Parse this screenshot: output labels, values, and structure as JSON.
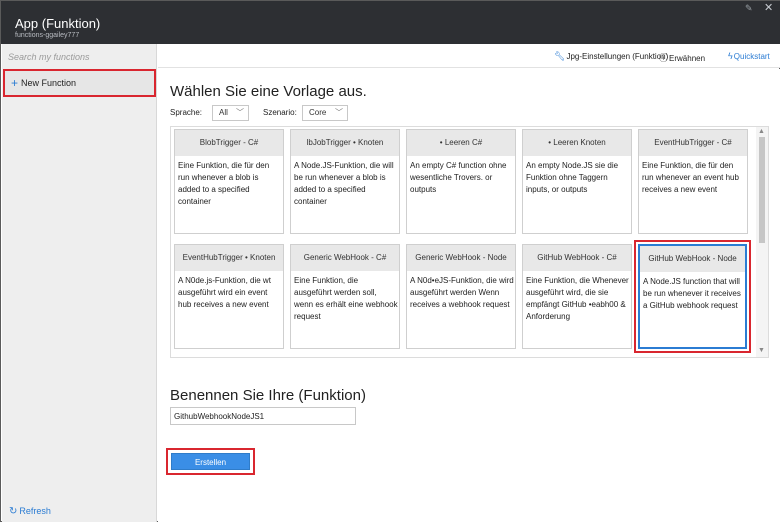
{
  "window": {
    "title": "App (Funktion)",
    "subtitle": "functions-ggailey777"
  },
  "sidebar": {
    "search_placeholder": "Search my functions",
    "new_function_label": "New Function",
    "refresh_label": "Refresh"
  },
  "toolbar": {
    "settings_label": "Jpg-Einstellungen (Funktion)",
    "mention_label": "Erwähnen",
    "quickstart_label": "Quickstart"
  },
  "main": {
    "heading": "Wählen Sie eine Vorlage aus.",
    "language_label": "Sprache:",
    "language_value": "All",
    "scenario_label": "Szenario:",
    "scenario_value": "Core",
    "templates": [
      {
        "title": "BlobTrigger - C#",
        "desc": "Eine Funktion, die für den run whenever a blob is added to a specified container"
      },
      {
        "title": "lbJobTrigger • Knoten",
        "desc": "A Node.JS-Funktion, die will be run whenever a blob is added to a specified container"
      },
      {
        "title": "• Leeren C#",
        "desc": "An empty C# function ohne wesentliche Trovers. or outputs"
      },
      {
        "title": "• Leeren Knoten",
        "desc": "An empty Node.JS sie die Funktion ohne Taggern inputs, or outputs"
      },
      {
        "title": "EventHubTrigger - C#",
        "desc": "Eine Funktion, die für den run whenever an event hub receives a new event"
      },
      {
        "title": "EventHubTrigger • Knoten",
        "desc": "A N0de.js-Funktion, die wt ausgeführt wird ein event hub receives a new event"
      },
      {
        "title": "Generic WebHook - C#",
        "desc": "Eine Funktion, die ausgeführt werden soll, wenn es erhält eine webhook request"
      },
      {
        "title": "Generic WebHook - Node",
        "desc": "A N0d•eJS-Funktion, die wird ausgeführt werden Wenn receives a webhook request"
      },
      {
        "title": "GitHub WebHook - C#",
        "desc": "Eine Funktion, die Whenever ausgeführt wird, die sie empfängt GitHub •eabh00 & Anforderung"
      },
      {
        "title": "GitHub WebHook - Node",
        "desc": "A Node.JS function that will be run whenever it receives a GitHub webhook request"
      }
    ],
    "name_heading": "Benennen Sie Ihre (Funktion)",
    "name_value": "GithubWebhookNodeJS1",
    "create_label": "Erstellen"
  },
  "colors": {
    "accent": "#2b7cd3",
    "highlight": "#d9262f",
    "titlebar": "#2d2f33",
    "button": "#3a8ee6"
  }
}
